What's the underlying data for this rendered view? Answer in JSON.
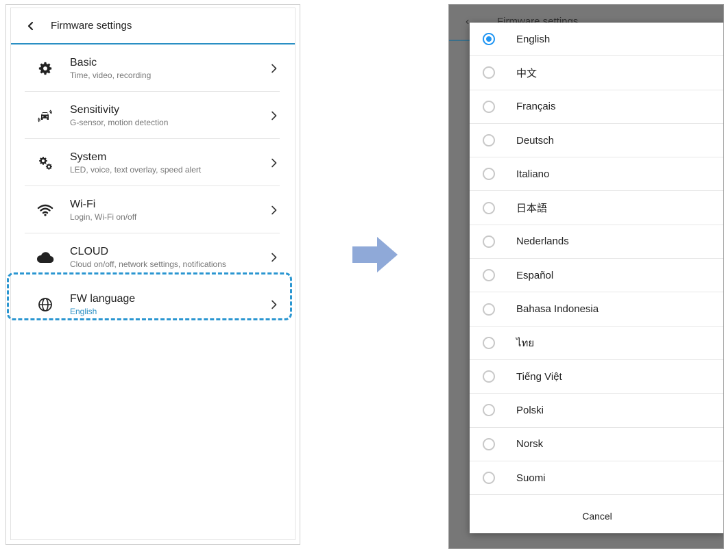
{
  "left_screen": {
    "title": "Firmware settings",
    "items": [
      {
        "icon": "gear-icon",
        "title": "Basic",
        "subtitle": "Time, video, recording"
      },
      {
        "icon": "car-sensor-icon",
        "title": "Sensitivity",
        "subtitle": "G-sensor, motion detection"
      },
      {
        "icon": "gears-icon",
        "title": "System",
        "subtitle": "LED, voice, text overlay, speed alert"
      },
      {
        "icon": "wifi-icon",
        "title": "Wi-Fi",
        "subtitle": "Login, Wi-Fi on/off"
      },
      {
        "icon": "cloud-icon",
        "title": "CLOUD",
        "subtitle": "Cloud on/off, network settings, notifications"
      },
      {
        "icon": "globe-icon",
        "title": "FW language",
        "subtitle": "English"
      }
    ]
  },
  "right_screen": {
    "background_title": "Firmware settings",
    "languages": [
      "English",
      "中文",
      "Français",
      "Deutsch",
      "Italiano",
      "日本語",
      "Nederlands",
      "Español",
      "Bahasa Indonesia",
      "ไทย",
      "Tiếng Việt",
      "Polski",
      "Norsk",
      "Suomi"
    ],
    "selected": "English",
    "cancel_label": "Cancel"
  },
  "colors": {
    "accent": "#2a8fc4",
    "radio_selected": "#2196f3",
    "highlight_border": "#2a96d1",
    "arrow": "#8fa9d8",
    "overlay": "#777777"
  }
}
